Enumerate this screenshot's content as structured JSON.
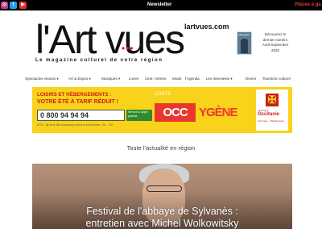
{
  "topbar": {
    "social": [
      {
        "icon": "instagram-icon",
        "glyph": "◎"
      },
      {
        "icon": "twitter-icon",
        "glyph": "t"
      },
      {
        "icon": "youtube-icon",
        "glyph": "▶"
      }
    ],
    "newsletter": "Newsletter",
    "promo": "Places à ga"
  },
  "header": {
    "logo": "l'Art vues",
    "logo_dots": "•••",
    "domain": "lartvues.com",
    "tagline": "Le magazine culturel de votre région",
    "magazine_promo": {
      "cover_title": "l'Art-vues",
      "line1": "Découvrez le",
      "line2": "dernier numéro",
      "line3": "Août-Septembre",
      "line4": "2020"
    }
  },
  "nav": {
    "items": [
      "Spectacles vivants ▾",
      "Art & Expos ▾",
      "Musiques ▾",
      "Livres",
      "Ciné / Séries",
      "Mode",
      "l'Agenda",
      "Les interviews ▾",
      "Divers",
      "Tourisme culturel"
    ]
  },
  "ad": {
    "title1": "LOISIRS ET HÉBERGEMENTS :",
    "title2": "VOTRE ÉTÉ À TARIF RÉDUIT !",
    "phone": "0 800 94 94 94",
    "service": "Service & appel gratuits",
    "sub": "5 FU - de 9h à 18h beaucoup ouvert et jours fériés - 9h - 17h",
    "carte": "CARTE",
    "occ": "OCC",
    "ygene": "YGÈNE",
    "region_line1": "La Région",
    "region_line2": "Occitanie",
    "region_line3": "Pyrénées - Méditerranée",
    "colors": {
      "background": "#f9d21a",
      "accent": "#e8382e"
    }
  },
  "main": {
    "section_title": "Toute l'actualité en région",
    "hero": {
      "title_line1": "Festival de l'abbaye de Sylvanès :",
      "title_line2": "entretien avec Michel Wolkowitsky"
    }
  }
}
